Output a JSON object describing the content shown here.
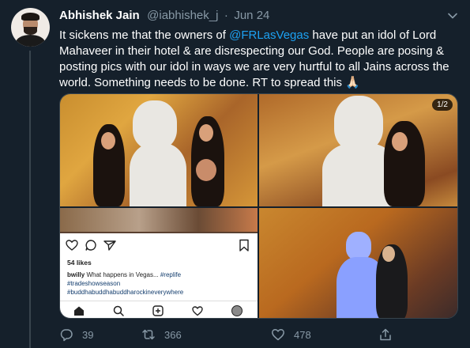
{
  "tweet": {
    "display_name": "Abhishek Jain",
    "handle": "@iabhishek_j",
    "separator": "·",
    "date": "Jun 24",
    "text_before_mention": "It sickens me that the owners of ",
    "mention": "@FRLasVegas",
    "text_after_mention": " have put an idol of Lord Mahaveer in their hotel & are disrespecting our God. People are posing & posting pics with our idol in ways we are very hurtful to all Jains across the world. Something needs to be done. RT to spread this 🙏🏻"
  },
  "media": {
    "counter": "1/2",
    "instagram_post": {
      "likes": "54 likes",
      "username": "bwilly",
      "caption": " What happens in Vegas... ",
      "hashtag_1": "#replife",
      "hashtag_2": "#tradeshowseason",
      "hashtag_3": "#buddhabuddhabuddharockineverywhere"
    }
  },
  "actions": {
    "reply_count": "39",
    "retweet_count": "366",
    "like_count": "478"
  },
  "colors": {
    "background": "#15202b",
    "accent": "#1da1f2",
    "secondary_text": "#8899a6",
    "divider": "#38444d"
  },
  "icons": [
    "chevron-down-icon",
    "reply-icon",
    "retweet-icon",
    "like-icon",
    "share-icon"
  ]
}
